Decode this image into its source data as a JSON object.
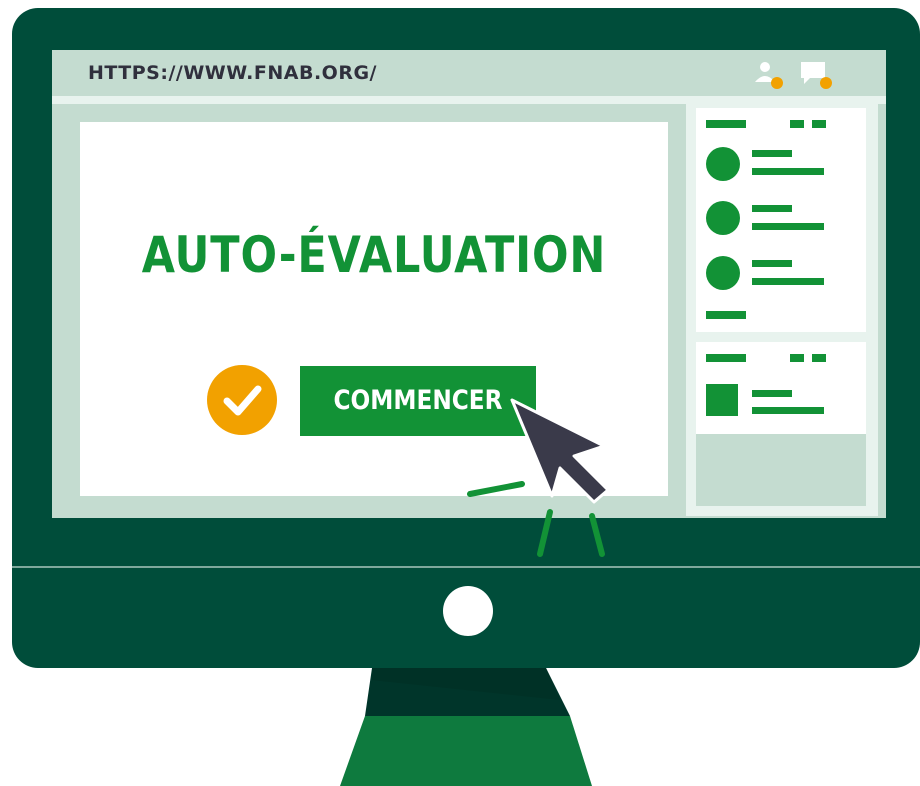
{
  "browser": {
    "url": "HTTPS://WWW.FNAB.ORG/",
    "icons": [
      "user-notification-icon",
      "chat-notification-icon"
    ]
  },
  "main": {
    "title": "AUTO-ÉVALUATION",
    "start_button_label": "COMMENCER",
    "status_icon": "check-icon"
  },
  "colors": {
    "monitor": "#004d3a",
    "accent_green": "#129236",
    "accent_orange": "#f2a100",
    "screen_bg": "#c4dcd0",
    "cursor": "#3a3a4a"
  }
}
